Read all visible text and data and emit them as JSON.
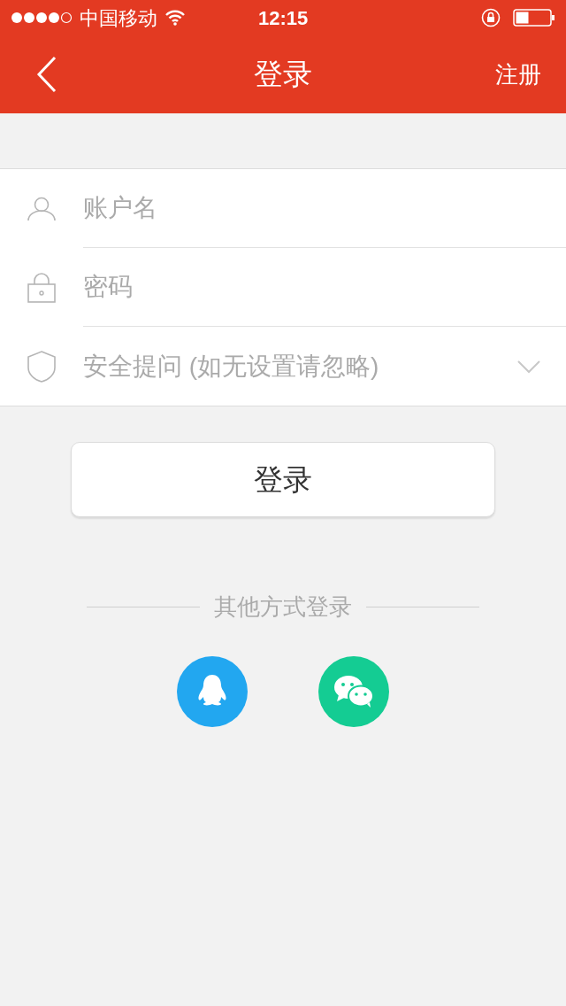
{
  "status_bar": {
    "carrier": "中国移动",
    "time": "12:15"
  },
  "nav_bar": {
    "title": "登录",
    "action": "注册"
  },
  "fields": [
    {
      "kind": "user",
      "placeholder": "账户名"
    },
    {
      "kind": "lock",
      "placeholder": "密码"
    },
    {
      "kind": "select",
      "placeholder": "安全提问 (如无设置请忽略)"
    }
  ],
  "login_button": "登录",
  "other_login": {
    "label": "其他方式登录",
    "providers": [
      {
        "kind": "penguin"
      },
      {
        "kind": "chat"
      }
    ]
  }
}
